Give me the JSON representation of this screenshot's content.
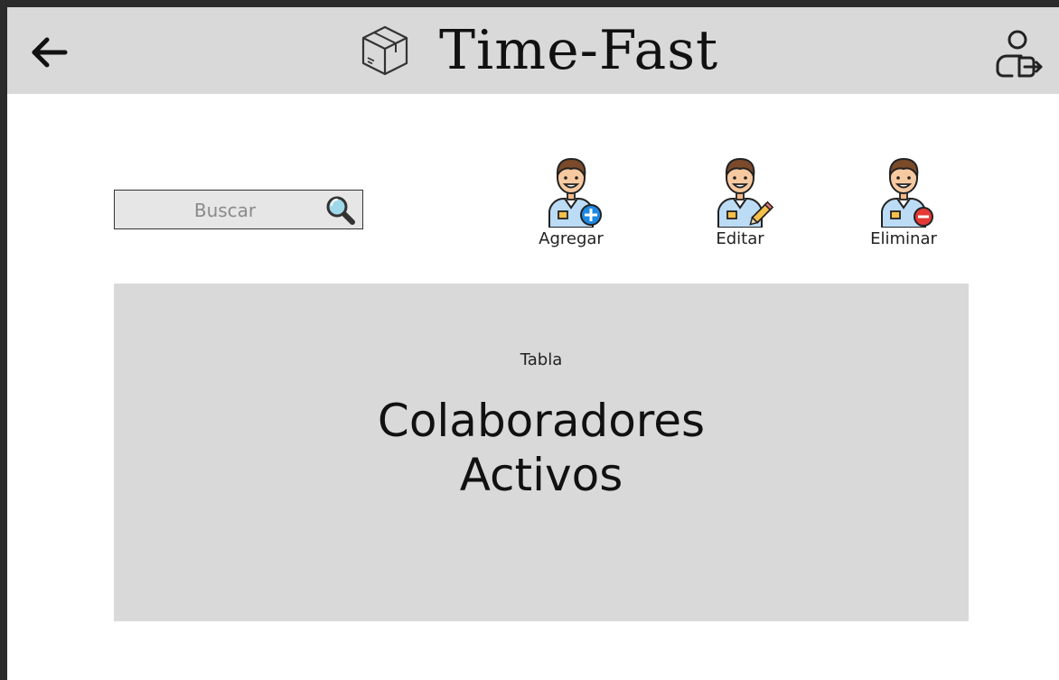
{
  "header": {
    "title": "Time-Fast",
    "back_icon": "arrow-left-icon",
    "brand_icon": "package-box-icon",
    "logout_icon": "user-logout-icon"
  },
  "search": {
    "placeholder": "Buscar",
    "icon": "magnifier-icon"
  },
  "actions": [
    {
      "label": "Agregar",
      "icon": "user-add-icon"
    },
    {
      "label": "Editar",
      "icon": "user-edit-icon"
    },
    {
      "label": "Eliminar",
      "icon": "user-remove-icon"
    }
  ],
  "table": {
    "caption": "Tabla",
    "title_line1": "Colaboradores",
    "title_line2": "Activos"
  },
  "colors": {
    "header_bg": "#d9d9d9",
    "table_bg": "#d9d9d9",
    "add_badge": "#1e88e5",
    "remove_badge": "#e53935"
  }
}
